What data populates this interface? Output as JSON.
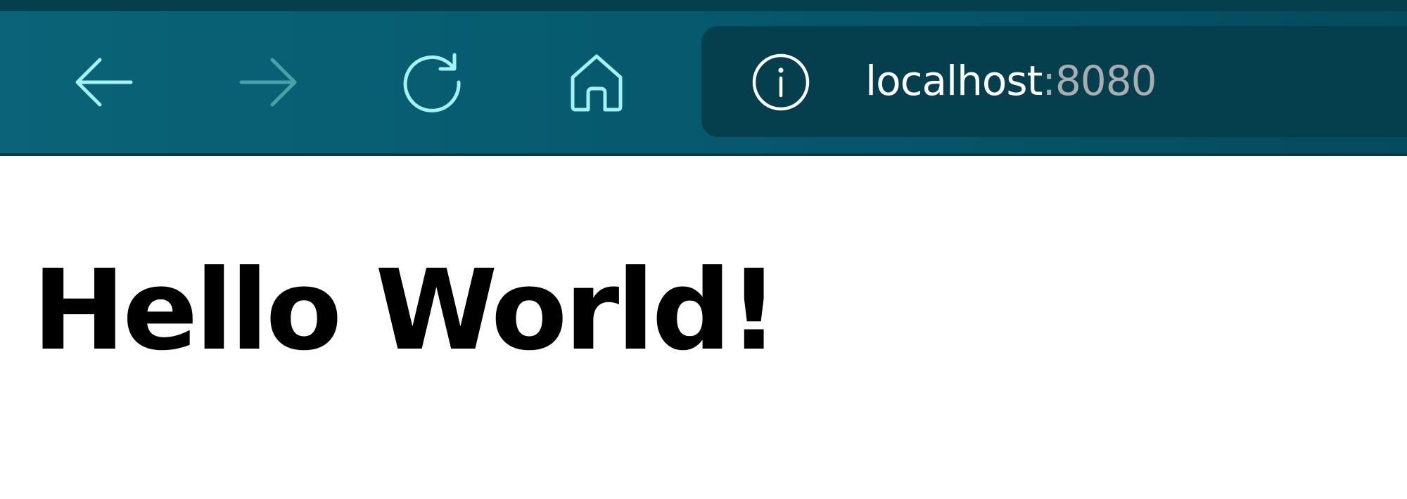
{
  "address_bar": {
    "host": "localhost",
    "port": ":8080"
  },
  "page": {
    "heading": "Hello World!"
  },
  "icons": {
    "back": "arrow-left-icon",
    "forward": "arrow-right-icon",
    "reload": "reload-icon",
    "home": "home-icon",
    "info": "info-icon"
  },
  "colors": {
    "chrome_background": "#075a6e",
    "address_bar_background": "#053f4e",
    "icon_active": "#a6f2f2",
    "icon_disabled": "#4aa0a8",
    "url_host": "#ffffff",
    "url_port": "#a8adb0",
    "page_background": "#ffffff",
    "heading_text": "#000000"
  },
  "state": {
    "forward_enabled": false
  }
}
